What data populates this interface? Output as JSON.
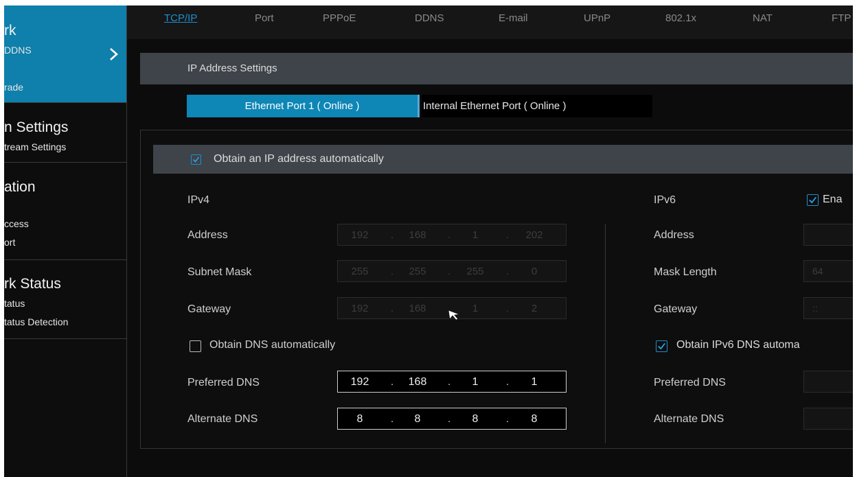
{
  "sidebar": {
    "network": {
      "title": "rk",
      "items": [
        "DDNS",
        "rade"
      ]
    },
    "record": {
      "title": "n Settings",
      "items": [
        "tream Settings"
      ]
    },
    "station": {
      "title": "ation",
      "items": [
        "ccess",
        "ort"
      ]
    },
    "status": {
      "title": "rk Status",
      "items": [
        "tatus",
        "tatus Detection"
      ]
    }
  },
  "tabs": [
    "TCP/IP",
    "Port",
    "PPPoE",
    "DDNS",
    "E-mail",
    "UPnP",
    "802.1x",
    "NAT",
    "FTP"
  ],
  "active_tab": "TCP/IP",
  "ip_settings": {
    "header": "IP Address Settings",
    "ports": [
      "Ethernet Port 1 ( Online )",
      "Internal Ethernet Port ( Online )"
    ],
    "obtain_auto_ip": {
      "label": "Obtain an IP address automatically",
      "checked": true
    }
  },
  "ipv4": {
    "heading": "IPv4",
    "address": {
      "label": "Address",
      "octets": [
        "192",
        "168",
        "1",
        "202"
      ]
    },
    "subnet_mask": {
      "label": "Subnet Mask",
      "octets": [
        "255",
        "255",
        "255",
        "0"
      ]
    },
    "gateway": {
      "label": "Gateway",
      "octets": [
        "192",
        "168",
        "1",
        "2"
      ]
    },
    "obtain_dns": {
      "label": "Obtain DNS automatically",
      "checked": false
    },
    "preferred_dns": {
      "label": "Preferred DNS",
      "octets": [
        "192",
        "168",
        "1",
        "1"
      ]
    },
    "alternate_dns": {
      "label": "Alternate DNS",
      "octets": [
        "8",
        "8",
        "8",
        "8"
      ]
    }
  },
  "ipv6": {
    "heading": "IPv6",
    "enable": {
      "label": "Ena",
      "checked": true
    },
    "address": {
      "label": "Address",
      "value": ""
    },
    "mask_length": {
      "label": "Mask Length",
      "value": "64"
    },
    "gateway": {
      "label": "Gateway",
      "value": "::"
    },
    "obtain_dns": {
      "label": "Obtain IPv6 DNS automa",
      "checked": true
    },
    "preferred_dns": {
      "label": "Preferred DNS",
      "value": ""
    },
    "alternate_dns": {
      "label": "Alternate DNS",
      "value": ""
    }
  },
  "colors": {
    "accent": "#0f7fab",
    "active_tab": "#1e8fd0",
    "header_bar": "#3e4449",
    "background": "#0c0c0c"
  }
}
